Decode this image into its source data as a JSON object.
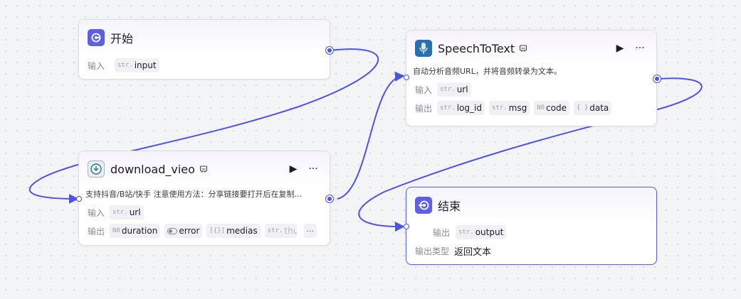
{
  "nodes": {
    "start": {
      "title": "开始",
      "input_label": "输入",
      "params": [
        {
          "type": "str.",
          "name": "input"
        }
      ]
    },
    "speech": {
      "title": "SpeechToText",
      "description": "自动分析音频URL，并将音频转录为文本。",
      "input_label": "输入",
      "output_label": "输出",
      "inputs": [
        {
          "type": "str.",
          "name": "url"
        }
      ],
      "outputs": [
        {
          "type": "str.",
          "name": "log_id"
        },
        {
          "type": "str.",
          "name": "msg"
        },
        {
          "type": "N0",
          "name": "code"
        },
        {
          "type": "{ }",
          "name": "data"
        }
      ]
    },
    "download": {
      "title": "download_vieo",
      "description": "支持抖音/B站/快手 注意使用方法：分享链接要打开后在复制…",
      "input_label": "输入",
      "output_label": "输出",
      "inputs": [
        {
          "type": "str.",
          "name": "url"
        }
      ],
      "outputs": [
        {
          "type": "N0",
          "name": "duration"
        },
        {
          "type": "toggle",
          "name": "error"
        },
        {
          "type": "[{}]",
          "name": "medias"
        },
        {
          "type": "str.",
          "name": "thum"
        }
      ],
      "more": "···"
    },
    "end": {
      "title": "结束",
      "output_label": "输出",
      "output_type_label": "输出类型",
      "output_type_value": "返回文本",
      "params": [
        {
          "type": "str.",
          "name": "output"
        }
      ]
    }
  },
  "actions": {
    "run": "▶",
    "more": "···"
  },
  "colors": {
    "accent": "#4d53e8",
    "edge": "#4d53e8",
    "node_border_selected": "#5d5fef"
  }
}
